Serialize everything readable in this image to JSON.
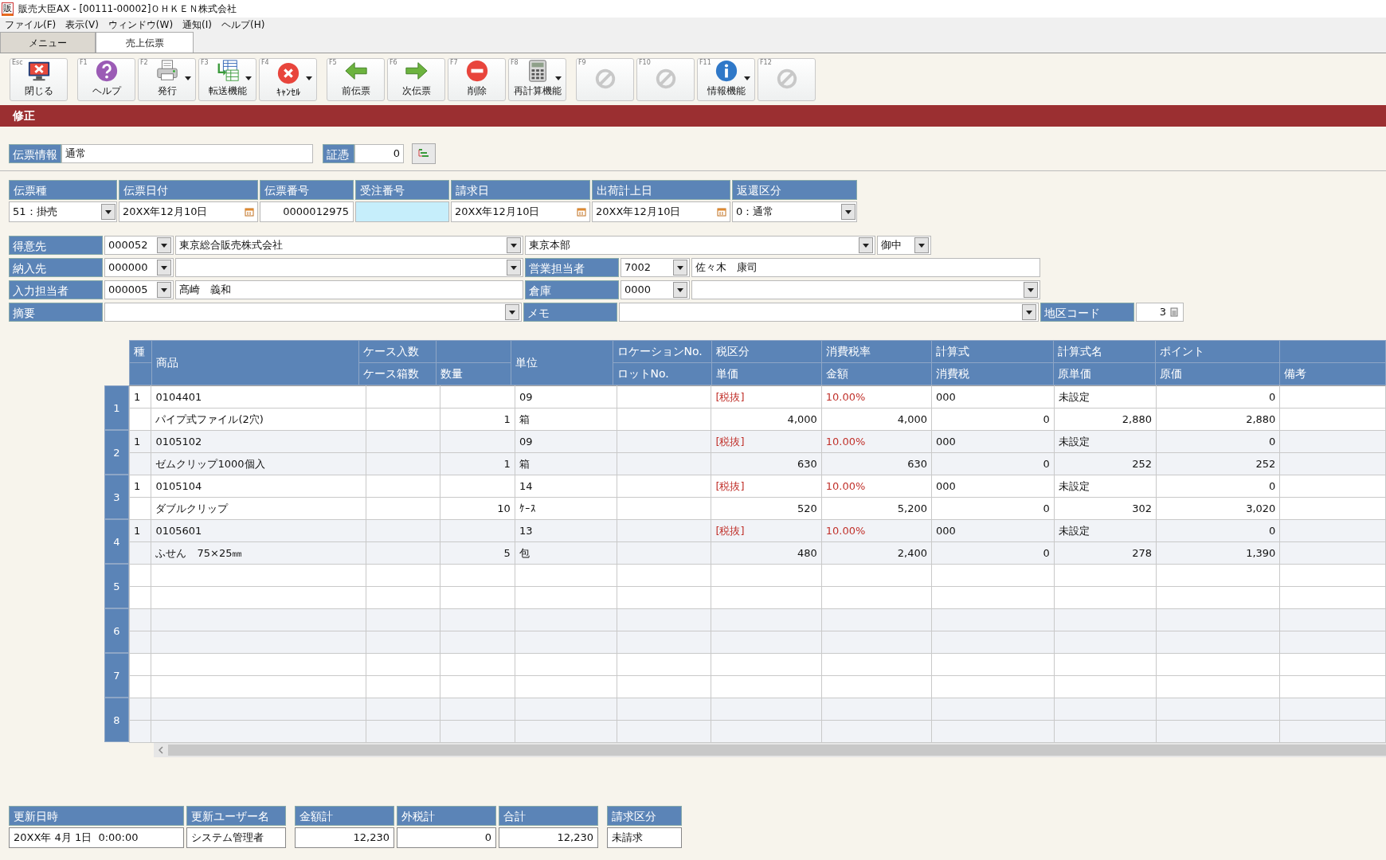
{
  "window": {
    "app_icon": "販",
    "title": "販売大臣AX - [00111-00002]ＯＨＫＥＮ株式会社"
  },
  "menu": [
    "ファイル(F)",
    "表示(V)",
    "ウィンドウ(W)",
    "通知(I)",
    "ヘルプ(H)"
  ],
  "tabs": [
    {
      "label": "メニュー",
      "selected": false
    },
    {
      "label": "売上伝票",
      "selected": true
    }
  ],
  "toolbar": [
    [
      {
        "key": "Esc",
        "label": "閉じる",
        "kind": "close",
        "dropdown": false,
        "disabled": false
      }
    ],
    [
      {
        "key": "F1",
        "label": "ヘルプ",
        "kind": "help",
        "dropdown": false,
        "disabled": false
      },
      {
        "key": "F2",
        "label": "発行",
        "kind": "print",
        "dropdown": true,
        "disabled": false
      },
      {
        "key": "F3",
        "label": "転送機能",
        "kind": "transfer",
        "dropdown": true,
        "disabled": false
      },
      {
        "key": "F4",
        "label": "ｷｬﾝｾﾙ",
        "kind": "cancel",
        "dropdown": true,
        "disabled": false
      }
    ],
    [
      {
        "key": "F5",
        "label": "前伝票",
        "kind": "prev",
        "dropdown": false,
        "disabled": false
      },
      {
        "key": "F6",
        "label": "次伝票",
        "kind": "next",
        "dropdown": false,
        "disabled": false
      },
      {
        "key": "F7",
        "label": "削除",
        "kind": "delete",
        "dropdown": false,
        "disabled": false
      },
      {
        "key": "F8",
        "label": "再計算機能",
        "kind": "calculator",
        "dropdown": true,
        "disabled": false
      }
    ],
    [
      {
        "key": "F9",
        "kind": "none",
        "dropdown": false,
        "disabled": true
      },
      {
        "key": "F10",
        "kind": "none",
        "dropdown": false,
        "disabled": true
      },
      {
        "key": "F11",
        "label": "情報機能",
        "kind": "info",
        "dropdown": true,
        "disabled": false
      },
      {
        "key": "F12",
        "kind": "none",
        "dropdown": false,
        "disabled": true
      }
    ]
  ],
  "mode_bar": "修正",
  "voucher_info": {
    "label": "伝票情報",
    "value": "通常",
    "evidence_label": "証憑",
    "evidence_value": "0"
  },
  "voucher_fields": [
    {
      "label": "伝票種",
      "value": "51：掛売",
      "kind": "select",
      "focused": false
    },
    {
      "label": "伝票日付",
      "value": "20XX年12月10日",
      "kind": "date",
      "focused": false
    },
    {
      "label": "伝票番号",
      "value": "0000012975",
      "kind": "number",
      "focused": false
    },
    {
      "label": "受注番号",
      "kind": "text",
      "focused": true
    },
    {
      "label": "請求日",
      "value": "20XX年12月10日",
      "kind": "date",
      "focused": false
    },
    {
      "label": "出荷計上日",
      "value": "20XX年12月10日",
      "kind": "date",
      "focused": false
    },
    {
      "label": "返還区分",
      "value": "0：通常",
      "kind": "select",
      "focused": false
    }
  ],
  "party_rows": [
    [
      {
        "kind": "label",
        "text": "得意先"
      },
      {
        "kind": "select",
        "value": "000052"
      },
      {
        "kind": "select",
        "value": "東京総合販売株式会社"
      },
      {
        "kind": "select",
        "value": "東京本部"
      },
      {
        "kind": "select",
        "value": "御中"
      }
    ],
    [
      {
        "kind": "label",
        "text": "納入先"
      },
      {
        "kind": "select",
        "value": "000000"
      },
      {
        "kind": "select"
      },
      {
        "kind": "label",
        "text": "営業担当者"
      },
      {
        "kind": "select",
        "value": "7002"
      },
      {
        "kind": "text",
        "value": "佐々木　康司"
      }
    ],
    [
      {
        "kind": "label",
        "text": "入力担当者"
      },
      {
        "kind": "select",
        "value": "000005"
      },
      {
        "kind": "text",
        "value": "髙崎　義和"
      },
      {
        "kind": "label",
        "text": "倉庫"
      },
      {
        "kind": "select",
        "value": "0000"
      },
      {
        "kind": "select"
      }
    ],
    [
      {
        "kind": "label",
        "text": "摘要"
      },
      {
        "kind": "select"
      },
      {
        "kind": "label",
        "text": "メモ"
      },
      {
        "kind": "select"
      },
      {
        "kind": "label",
        "text": "地区コード"
      },
      {
        "kind": "number",
        "value": "3"
      }
    ]
  ],
  "grid": {
    "columns": [
      {
        "top": "種"
      },
      {
        "label": "商品"
      },
      {
        "top": "ケース入数",
        "bottom": "ケース箱数"
      },
      {
        "bottom": "数量"
      },
      {
        "label": "単位"
      },
      {
        "top": "ロケーションNo.",
        "bottom": "ロットNo."
      },
      {
        "top": "税区分",
        "bottom": "単価"
      },
      {
        "top": "消費税率",
        "bottom": "金額"
      },
      {
        "top": "計算式",
        "bottom": "消費税"
      },
      {
        "top": "計算式名",
        "bottom": "原単価"
      },
      {
        "top": "ポイント",
        "bottom": "原価"
      },
      {
        "bottom": "備考"
      }
    ],
    "rows": [
      {
        "number": "1",
        "type_code": "1",
        "code": "0104401",
        "unit_code": "09",
        "tax_type": "[税抜]",
        "tax_rate": "10.00%",
        "formula": "000",
        "formula_name": "未設定",
        "point": "0",
        "name": "パイプ式ファイル(2穴)",
        "quantity": "1",
        "unit": "箱",
        "unit_price": "4,000",
        "amount": "4,000",
        "tax": "0",
        "cost_unit_price": "2,880",
        "cost": "2,880"
      },
      {
        "number": "2",
        "type_code": "1",
        "code": "0105102",
        "unit_code": "09",
        "tax_type": "[税抜]",
        "tax_rate": "10.00%",
        "formula": "000",
        "formula_name": "未設定",
        "point": "0",
        "name": "ゼムクリップ1000個入",
        "quantity": "1",
        "unit": "箱",
        "unit_price": "630",
        "amount": "630",
        "tax": "0",
        "cost_unit_price": "252",
        "cost": "252"
      },
      {
        "number": "3",
        "type_code": "1",
        "code": "0105104",
        "unit_code": "14",
        "tax_type": "[税抜]",
        "tax_rate": "10.00%",
        "formula": "000",
        "formula_name": "未設定",
        "point": "0",
        "name": "ダブルクリップ",
        "quantity": "10",
        "unit": "ｹｰｽ",
        "unit_price": "520",
        "amount": "5,200",
        "tax": "0",
        "cost_unit_price": "302",
        "cost": "3,020"
      },
      {
        "number": "4",
        "type_code": "1",
        "code": "0105601",
        "unit_code": "13",
        "tax_type": "[税抜]",
        "tax_rate": "10.00%",
        "formula": "000",
        "formula_name": "未設定",
        "point": "0",
        "name": "ふせん　75×25㎜",
        "quantity": "5",
        "unit": "包",
        "unit_price": "480",
        "amount": "2,400",
        "tax": "0",
        "cost_unit_price": "278",
        "cost": "1,390"
      },
      {
        "number": "5"
      },
      {
        "number": "6"
      },
      {
        "number": "7"
      },
      {
        "number": "8"
      }
    ]
  },
  "footer": [
    [
      {
        "label": "更新日時",
        "value": "20XX年 4月 1日  0:00:00"
      },
      {
        "label": "更新ユーザー名",
        "value": "システム管理者"
      }
    ],
    [
      {
        "label": "金額計",
        "value": "12,230"
      },
      {
        "label": "外税計",
        "value": "0"
      },
      {
        "label": "合計",
        "value": "12,230"
      }
    ],
    [
      {
        "label": "請求区分",
        "value": "未請求"
      }
    ]
  ]
}
